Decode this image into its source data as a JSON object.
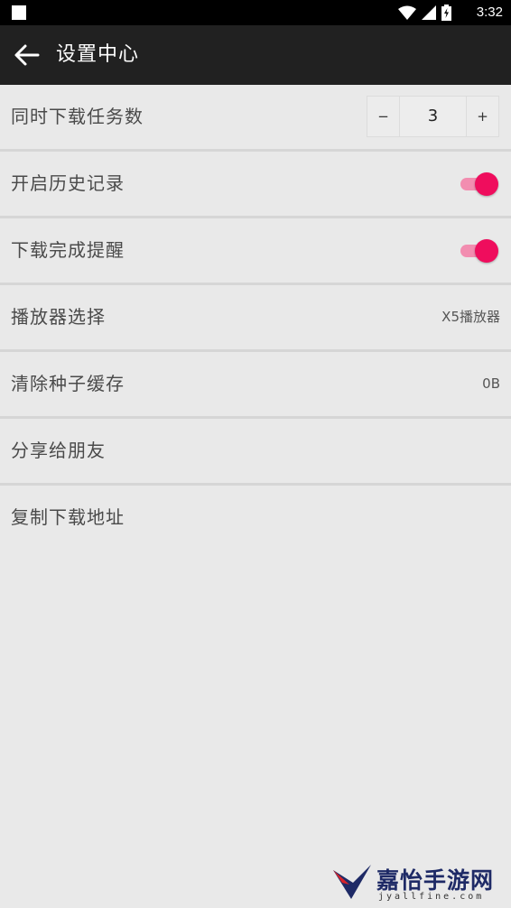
{
  "status_bar": {
    "time": "3:32"
  },
  "app_bar": {
    "title": "设置中心"
  },
  "settings": [
    {
      "label": "同时下载任务数",
      "control": "stepper",
      "value": "3",
      "minus": "−",
      "plus": "+"
    },
    {
      "label": "开启历史记录",
      "control": "toggle",
      "on": true
    },
    {
      "label": "下载完成提醒",
      "control": "toggle",
      "on": true
    },
    {
      "label": "播放器选择",
      "control": "value",
      "value": "X5播放器"
    },
    {
      "label": "清除种子缓存",
      "control": "value",
      "value": "0B"
    },
    {
      "label": "分享给朋友",
      "control": "none"
    },
    {
      "label": "复制下载地址",
      "control": "none"
    }
  ],
  "colors": {
    "accent": "#ef0d5d",
    "accent_track": "#f28db0",
    "app_bar": "#212121",
    "background": "#e9e9e9"
  },
  "watermark": {
    "text": "嘉怡手游网",
    "url": "jyallfine.com"
  }
}
